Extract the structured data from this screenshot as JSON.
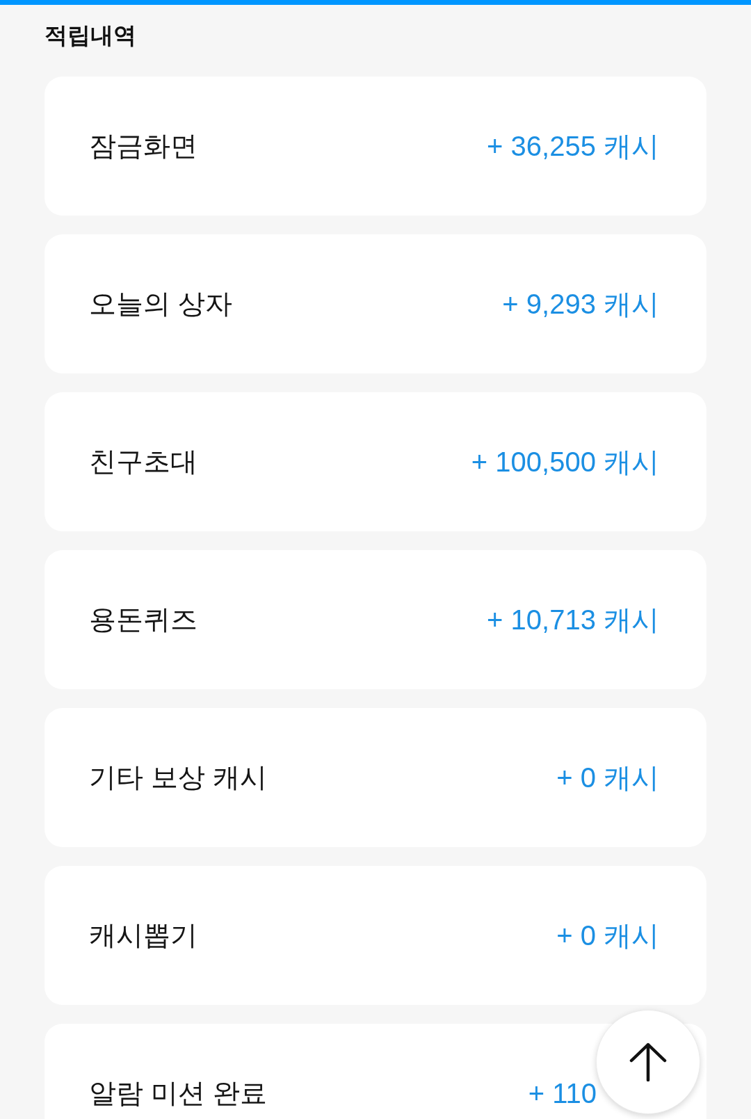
{
  "section_title": "적립내역",
  "rewards": [
    {
      "name": "잠금화면",
      "amount": "+ 36,255 캐시"
    },
    {
      "name": "오늘의 상자",
      "amount": "+ 9,293 캐시"
    },
    {
      "name": "친구초대",
      "amount": "+ 100,500 캐시"
    },
    {
      "name": "용돈퀴즈",
      "amount": "+ 10,713 캐시"
    },
    {
      "name": "기타 보상 캐시",
      "amount": "+ 0 캐시"
    },
    {
      "name": "캐시뽑기",
      "amount": "+ 0 캐시"
    },
    {
      "name": "알람 미션 완료",
      "amount": "+ 110"
    }
  ]
}
